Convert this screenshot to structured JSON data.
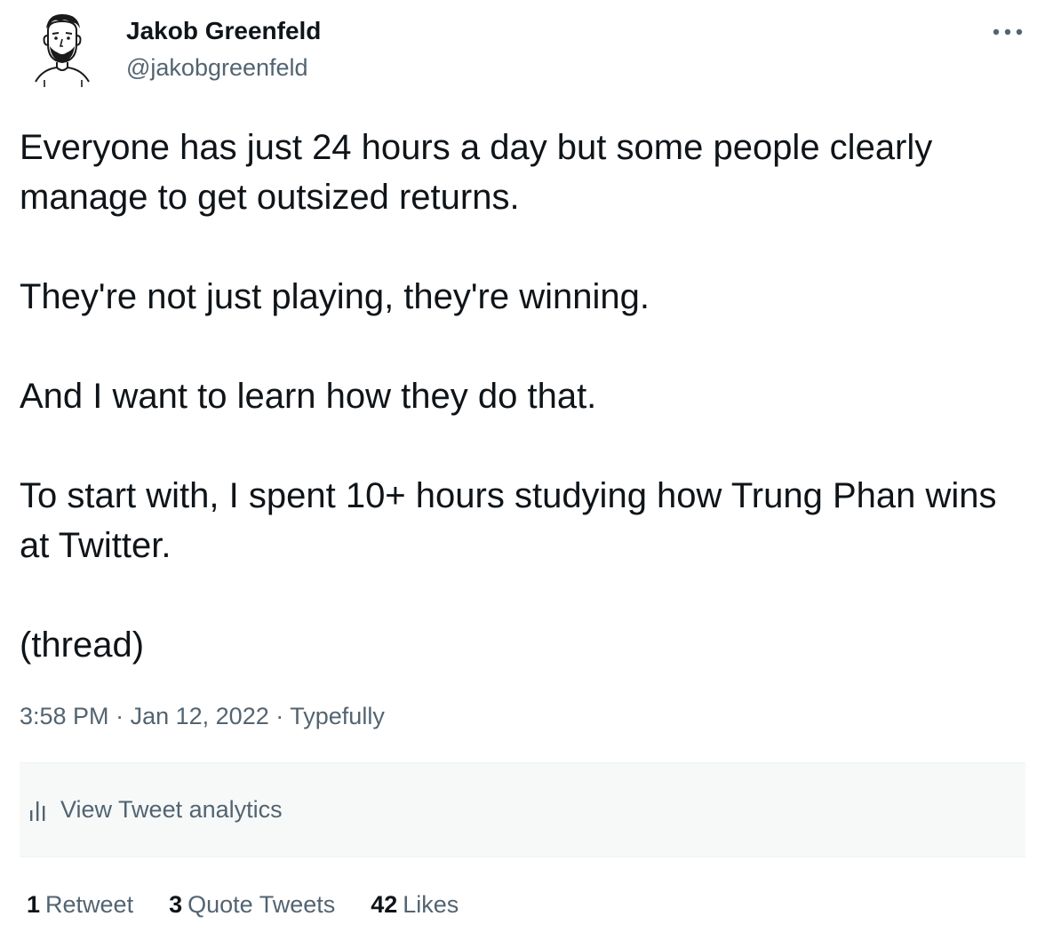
{
  "author": {
    "name": "Jakob Greenfeld",
    "handle": "@jakobgreenfeld"
  },
  "tweet": {
    "paragraphs": [
      "Everyone has just 24 hours a day but some people clearly manage to get outsized returns.",
      "They're not just playing, they're winning.",
      "And I want to learn how they do that.",
      "To start with, I spent 10+ hours studying how Trung Phan wins at Twitter.",
      "(thread)"
    ],
    "time": "3:58 PM",
    "separator": "·",
    "date": "Jan 12, 2022",
    "source": "Typefully"
  },
  "analytics": {
    "label": "View Tweet analytics",
    "icon": "bar-chart-icon"
  },
  "stats": {
    "retweets": {
      "count": "1",
      "label": "Retweet"
    },
    "quote_tweets": {
      "count": "3",
      "label": "Quote Tweets"
    },
    "likes": {
      "count": "42",
      "label": "Likes"
    }
  },
  "colors": {
    "text": "#0f1419",
    "secondary": "#536471",
    "analytics_bg": "#f7f9f9"
  }
}
